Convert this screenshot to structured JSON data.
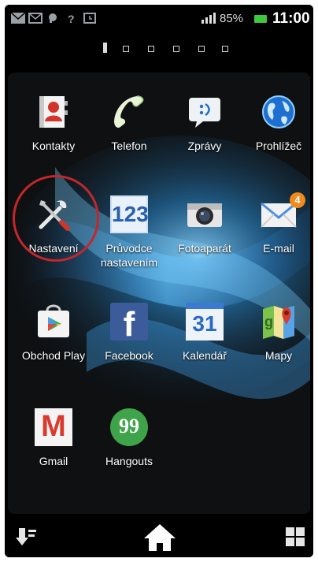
{
  "status_bar": {
    "battery_percent": "85%",
    "time": "11:00",
    "icons": [
      "mail-icon",
      "mail-icon",
      "chat-icon",
      "help-icon",
      "alarm-icon"
    ]
  },
  "home_pages": {
    "total": 6,
    "active": 1
  },
  "apps": [
    {
      "id": "kontakty",
      "label": "Kontakty",
      "icon": "contacts-icon"
    },
    {
      "id": "telefon",
      "label": "Telefon",
      "icon": "phone-icon"
    },
    {
      "id": "zpravy",
      "label": "Zprávy",
      "icon": "messages-icon"
    },
    {
      "id": "prohlizec",
      "label": "Prohlížeč",
      "icon": "browser-icon"
    },
    {
      "id": "nastaveni",
      "label": "Nastavení",
      "icon": "settings-icon"
    },
    {
      "id": "pruvodce",
      "label": "Průvodce nastavením",
      "icon": "setup-guide-icon",
      "icon_text": "123"
    },
    {
      "id": "fotoaparat",
      "label": "Fotoaparát",
      "icon": "camera-icon"
    },
    {
      "id": "email",
      "label": "E-mail",
      "icon": "email-icon",
      "badge": "4"
    },
    {
      "id": "obchod",
      "label": "Obchod Play",
      "icon": "play-store-icon"
    },
    {
      "id": "facebook",
      "label": "Facebook",
      "icon": "facebook-icon",
      "icon_text": "f"
    },
    {
      "id": "kalendar",
      "label": "Kalendář",
      "icon": "calendar-icon",
      "icon_text": "31"
    },
    {
      "id": "mapy",
      "label": "Mapy",
      "icon": "maps-icon"
    },
    {
      "id": "gmail",
      "label": "Gmail",
      "icon": "gmail-icon",
      "icon_text": "M"
    },
    {
      "id": "hangouts",
      "label": "Hangouts",
      "icon": "hangouts-icon",
      "icon_text": "99"
    }
  ],
  "highlighted_app": "Nastavení",
  "nav": {
    "left": "sort-icon",
    "center": "home-icon",
    "right": "grid-icon"
  },
  "colors": {
    "highlight_ring": "#c4262c",
    "accent_blue": "#1f6fd1"
  }
}
